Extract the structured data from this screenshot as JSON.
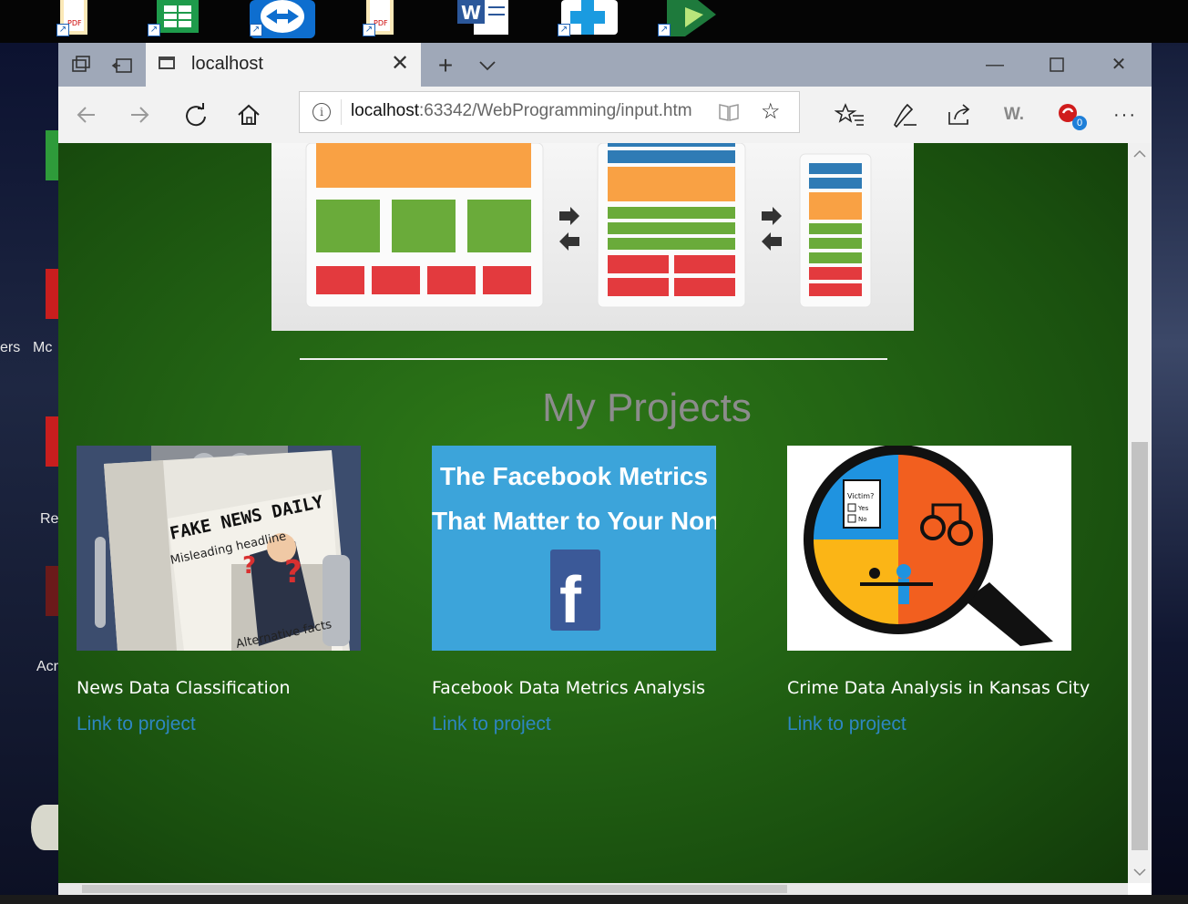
{
  "browser": {
    "tab_title": "localhost",
    "address_host": "localhost",
    "address_rest": ":63342/WebProgramming/input.htm",
    "extension_badge": "0",
    "extension_label": "W."
  },
  "desktop": {
    "left_labels": [
      "ers",
      "Mc",
      "Re",
      "Acr"
    ]
  },
  "page": {
    "section_title": "My Projects",
    "projects": [
      {
        "title": "News Data Classification",
        "link_text": "Link to project",
        "image_text": {
          "headline": "FAKE NEWS DAILY",
          "sub": "Misleading headline",
          "footer": "Alternative facts"
        }
      },
      {
        "title": "Facebook Data Metrics Analysis",
        "link_text": "Link to project",
        "image_text": {
          "line1": "The Facebook Metrics",
          "line2": "That Matter to Your Nonprofit"
        }
      },
      {
        "title": "Crime Data Analysis in Kansas City",
        "link_text": "Link to project",
        "image_text": {
          "victim": "Victim?",
          "yes": "Yes",
          "no": "No"
        }
      }
    ]
  },
  "colors": {
    "link": "#2e86c1",
    "page_background": "#236414",
    "title_text": "#8c8c8c"
  }
}
